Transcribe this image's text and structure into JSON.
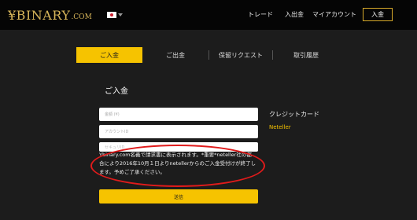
{
  "header": {
    "logo_main": "¥BINARY",
    "logo_suffix": ".COM",
    "language_flag": "japan-flag-icon",
    "nav": {
      "trade": "トレード",
      "deposit_withdraw": "入出金",
      "my_account": "マイアカウント"
    },
    "login_button": "入金"
  },
  "tabs": [
    {
      "label": "ご入金",
      "active": true
    },
    {
      "label": "ご出金",
      "active": false
    },
    {
      "label": "保留リクエスト",
      "active": false
    },
    {
      "label": "取引履歴",
      "active": false
    }
  ],
  "form": {
    "title": "ご入金",
    "amount_placeholder": "金額 (¥)",
    "account_id_placeholder": "アカウントID",
    "security_placeholder": "セキュリID",
    "submit_label": "送信"
  },
  "payment_methods": {
    "credit_card": "クレジットカード",
    "neteller": "Neteller"
  },
  "notice": {
    "line1": "Ybinary.com名義で請求書に表示されます。*重要*neteller社の都",
    "line2": "合により2016年10月１日よりnetellerからのご入金受付けが終了し",
    "line3": "ます。予めご了承ください。"
  },
  "colors": {
    "accent": "#f6c300",
    "logo_gold": "#d8b65a",
    "highlight_oval": "#e01b1b",
    "background": "#1c1c1c",
    "header_bg": "#050505"
  }
}
